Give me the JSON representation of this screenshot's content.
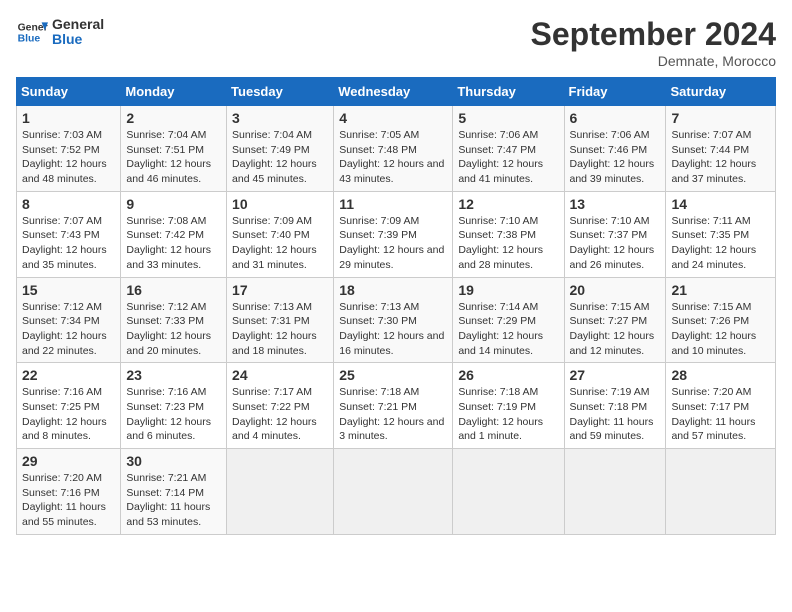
{
  "header": {
    "logo_general": "General",
    "logo_blue": "Blue",
    "month_title": "September 2024",
    "location": "Demnate, Morocco"
  },
  "calendar": {
    "days_of_week": [
      "Sunday",
      "Monday",
      "Tuesday",
      "Wednesday",
      "Thursday",
      "Friday",
      "Saturday"
    ],
    "weeks": [
      [
        {
          "day": "",
          "empty": true
        },
        {
          "day": "",
          "empty": true
        },
        {
          "day": "",
          "empty": true
        },
        {
          "day": "",
          "empty": true
        },
        {
          "day": "",
          "empty": true
        },
        {
          "day": "",
          "empty": true
        },
        {
          "day": "",
          "empty": true
        }
      ],
      [
        {
          "day": "1",
          "sunrise": "7:03 AM",
          "sunset": "7:52 PM",
          "daylight": "12 hours and 48 minutes."
        },
        {
          "day": "2",
          "sunrise": "7:04 AM",
          "sunset": "7:51 PM",
          "daylight": "12 hours and 46 minutes."
        },
        {
          "day": "3",
          "sunrise": "7:04 AM",
          "sunset": "7:49 PM",
          "daylight": "12 hours and 45 minutes."
        },
        {
          "day": "4",
          "sunrise": "7:05 AM",
          "sunset": "7:48 PM",
          "daylight": "12 hours and 43 minutes."
        },
        {
          "day": "5",
          "sunrise": "7:06 AM",
          "sunset": "7:47 PM",
          "daylight": "12 hours and 41 minutes."
        },
        {
          "day": "6",
          "sunrise": "7:06 AM",
          "sunset": "7:46 PM",
          "daylight": "12 hours and 39 minutes."
        },
        {
          "day": "7",
          "sunrise": "7:07 AM",
          "sunset": "7:44 PM",
          "daylight": "12 hours and 37 minutes."
        }
      ],
      [
        {
          "day": "8",
          "sunrise": "7:07 AM",
          "sunset": "7:43 PM",
          "daylight": "12 hours and 35 minutes."
        },
        {
          "day": "9",
          "sunrise": "7:08 AM",
          "sunset": "7:42 PM",
          "daylight": "12 hours and 33 minutes."
        },
        {
          "day": "10",
          "sunrise": "7:09 AM",
          "sunset": "7:40 PM",
          "daylight": "12 hours and 31 minutes."
        },
        {
          "day": "11",
          "sunrise": "7:09 AM",
          "sunset": "7:39 PM",
          "daylight": "12 hours and 29 minutes."
        },
        {
          "day": "12",
          "sunrise": "7:10 AM",
          "sunset": "7:38 PM",
          "daylight": "12 hours and 28 minutes."
        },
        {
          "day": "13",
          "sunrise": "7:10 AM",
          "sunset": "7:37 PM",
          "daylight": "12 hours and 26 minutes."
        },
        {
          "day": "14",
          "sunrise": "7:11 AM",
          "sunset": "7:35 PM",
          "daylight": "12 hours and 24 minutes."
        }
      ],
      [
        {
          "day": "15",
          "sunrise": "7:12 AM",
          "sunset": "7:34 PM",
          "daylight": "12 hours and 22 minutes."
        },
        {
          "day": "16",
          "sunrise": "7:12 AM",
          "sunset": "7:33 PM",
          "daylight": "12 hours and 20 minutes."
        },
        {
          "day": "17",
          "sunrise": "7:13 AM",
          "sunset": "7:31 PM",
          "daylight": "12 hours and 18 minutes."
        },
        {
          "day": "18",
          "sunrise": "7:13 AM",
          "sunset": "7:30 PM",
          "daylight": "12 hours and 16 minutes."
        },
        {
          "day": "19",
          "sunrise": "7:14 AM",
          "sunset": "7:29 PM",
          "daylight": "12 hours and 14 minutes."
        },
        {
          "day": "20",
          "sunrise": "7:15 AM",
          "sunset": "7:27 PM",
          "daylight": "12 hours and 12 minutes."
        },
        {
          "day": "21",
          "sunrise": "7:15 AM",
          "sunset": "7:26 PM",
          "daylight": "12 hours and 10 minutes."
        }
      ],
      [
        {
          "day": "22",
          "sunrise": "7:16 AM",
          "sunset": "7:25 PM",
          "daylight": "12 hours and 8 minutes."
        },
        {
          "day": "23",
          "sunrise": "7:16 AM",
          "sunset": "7:23 PM",
          "daylight": "12 hours and 6 minutes."
        },
        {
          "day": "24",
          "sunrise": "7:17 AM",
          "sunset": "7:22 PM",
          "daylight": "12 hours and 4 minutes."
        },
        {
          "day": "25",
          "sunrise": "7:18 AM",
          "sunset": "7:21 PM",
          "daylight": "12 hours and 3 minutes."
        },
        {
          "day": "26",
          "sunrise": "7:18 AM",
          "sunset": "7:19 PM",
          "daylight": "12 hours and 1 minute."
        },
        {
          "day": "27",
          "sunrise": "7:19 AM",
          "sunset": "7:18 PM",
          "daylight": "11 hours and 59 minutes."
        },
        {
          "day": "28",
          "sunrise": "7:20 AM",
          "sunset": "7:17 PM",
          "daylight": "11 hours and 57 minutes."
        }
      ],
      [
        {
          "day": "29",
          "sunrise": "7:20 AM",
          "sunset": "7:16 PM",
          "daylight": "11 hours and 55 minutes."
        },
        {
          "day": "30",
          "sunrise": "7:21 AM",
          "sunset": "7:14 PM",
          "daylight": "11 hours and 53 minutes."
        },
        {
          "day": "",
          "empty": true
        },
        {
          "day": "",
          "empty": true
        },
        {
          "day": "",
          "empty": true
        },
        {
          "day": "",
          "empty": true
        },
        {
          "day": "",
          "empty": true
        }
      ]
    ]
  }
}
